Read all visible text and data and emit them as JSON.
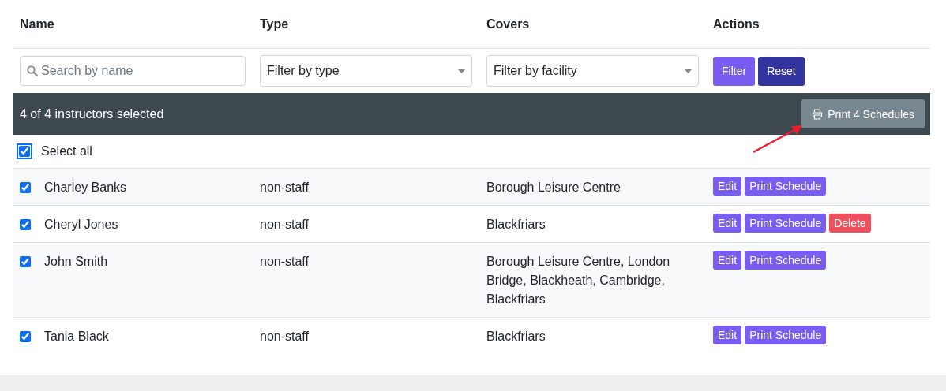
{
  "table": {
    "columns": [
      "Name",
      "Type",
      "Covers",
      "Actions"
    ],
    "filters": {
      "search": {
        "placeholder": "Search by name"
      },
      "type_select": {
        "value": "Filter by type"
      },
      "facility_select": {
        "value": "Filter by facility"
      },
      "buttons": [
        {
          "label": "Filter",
          "kind": "primary"
        },
        {
          "label": "Reset",
          "kind": "dark"
        }
      ]
    },
    "selection_bar": {
      "text": "4 of 4 instructors selected",
      "print_button": "Print 4 Schedules"
    },
    "select_all": {
      "label": "Select all",
      "checked": true
    },
    "rows": [
      {
        "name": "Charley Banks",
        "type": "non-staff",
        "covers": "Borough Leisure Centre",
        "checked": true,
        "actions": [
          {
            "label": "Edit",
            "kind": "edit"
          },
          {
            "label": "Print Schedule",
            "kind": "print"
          }
        ]
      },
      {
        "name": "Cheryl Jones",
        "type": "non-staff",
        "covers": "Blackfriars",
        "checked": true,
        "actions": [
          {
            "label": "Edit",
            "kind": "edit"
          },
          {
            "label": "Print Schedule",
            "kind": "print"
          },
          {
            "label": "Delete",
            "kind": "delete"
          }
        ]
      },
      {
        "name": "John Smith",
        "type": "non-staff",
        "covers": "Borough Leisure Centre, London Bridge, Blackheath, Cambridge, Blackfriars",
        "checked": true,
        "actions": [
          {
            "label": "Edit",
            "kind": "edit"
          },
          {
            "label": "Print Schedule",
            "kind": "print"
          }
        ]
      },
      {
        "name": "Tania Black",
        "type": "non-staff",
        "covers": "Blackfriars",
        "checked": true,
        "actions": [
          {
            "label": "Edit",
            "kind": "edit"
          },
          {
            "label": "Print Schedule",
            "kind": "print"
          }
        ]
      }
    ]
  }
}
